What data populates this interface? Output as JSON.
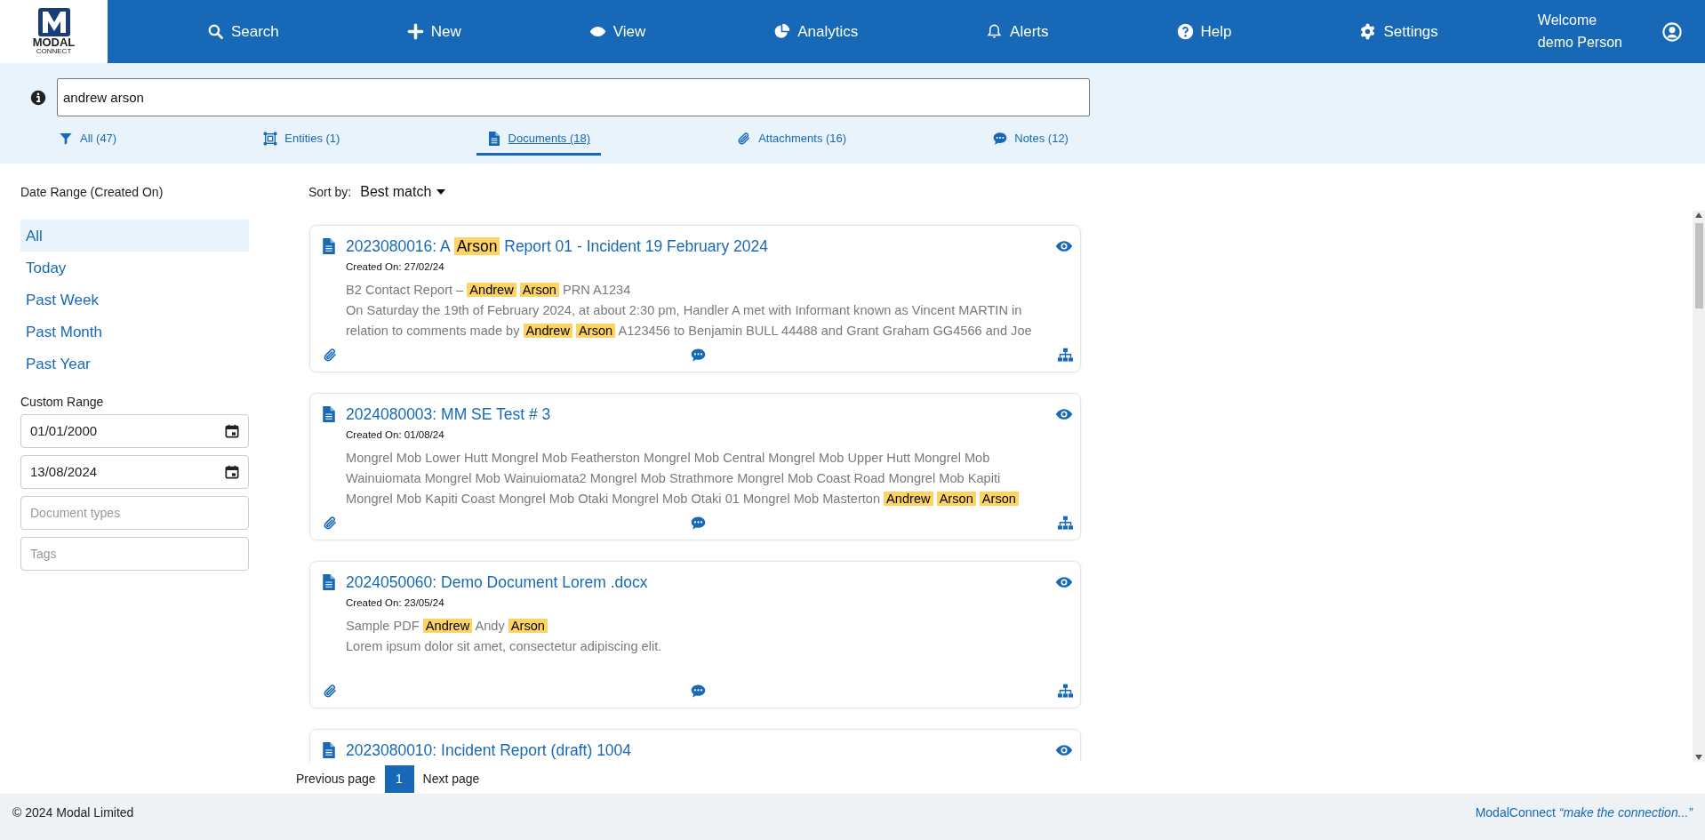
{
  "header": {
    "logo": {
      "line1": "MODAL",
      "line2": "CONNECT"
    },
    "nav": [
      {
        "label": "Search"
      },
      {
        "label": "New"
      },
      {
        "label": "View"
      },
      {
        "label": "Analytics"
      },
      {
        "label": "Alerts"
      },
      {
        "label": "Help"
      },
      {
        "label": "Settings"
      }
    ],
    "welcome": [
      "Welcome",
      "demo Person"
    ]
  },
  "search": {
    "value": "andrew arson"
  },
  "filters": [
    {
      "label": "All (47)",
      "selected": false
    },
    {
      "label": "Entities (1)",
      "selected": false
    },
    {
      "label": "Documents (18)",
      "selected": true
    },
    {
      "label": "Attachments (16)",
      "selected": false
    },
    {
      "label": "Notes (12)",
      "selected": false
    }
  ],
  "sidebar": {
    "heading": "Date Range (Created On)",
    "ranges": [
      {
        "label": "All",
        "selected": true
      },
      {
        "label": "Today",
        "selected": false
      },
      {
        "label": "Past Week",
        "selected": false
      },
      {
        "label": "Past Month",
        "selected": false
      },
      {
        "label": "Past Year",
        "selected": false
      }
    ],
    "custom_heading": "Custom Range",
    "from": "01/01/2000",
    "to": "13/08/2024",
    "doc_types": {
      "placeholder": "Document types"
    },
    "tags": {
      "placeholder": "Tags"
    }
  },
  "sort": {
    "label": "Sort by:",
    "value": "Best match"
  },
  "results": [
    {
      "title": [
        {
          "text": "2023080016: A ",
          "highlight": false
        },
        {
          "text": "Arson",
          "highlight": true
        },
        {
          "text": " Report 01 - Incident 19 February 2024",
          "highlight": false
        }
      ],
      "created": "Created On: 27/02/24",
      "snippet": [
        [
          {
            "text": "B2 Contact Report – ",
            "highlight": false
          },
          {
            "text": "Andrew",
            "highlight": true
          },
          {
            "text": "Arson",
            "highlight": true
          },
          {
            "text": " PRN A1234",
            "highlight": false
          }
        ],
        [
          {
            "text": "On Saturday the 19th of February 2024, at about 2:30 pm, Handler A met with Informant known as Vincent MARTIN in",
            "highlight": false
          }
        ],
        [
          {
            "text": "relation to comments made by ",
            "highlight": false
          },
          {
            "text": "Andrew",
            "highlight": true
          },
          {
            "text": "Arson",
            "highlight": true
          },
          {
            "text": " A123456 to Benjamin BULL 44488 and Grant Graham GG4566 and Joe",
            "highlight": false
          }
        ]
      ]
    },
    {
      "title": [
        {
          "text": "2024080003: MM SE Test # 3",
          "highlight": false
        }
      ],
      "created": "Created On: 01/08/24",
      "snippet": [
        [
          {
            "text": "Mongrel Mob Lower Hutt Mongrel Mob Featherston Mongrel Mob Central Mongrel Mob Upper Hutt Mongrel Mob",
            "highlight": false
          }
        ],
        [
          {
            "text": "Wainuiomata Mongrel Mob Wainuiomata2 Mongrel Mob Strathmore Mongrel Mob Coast Road Mongrel Mob Kapiti",
            "highlight": false
          }
        ],
        [
          {
            "text": "Mongrel Mob Kapiti Coast Mongrel Mob Otaki Mongrel Mob Otaki 01 Mongrel Mob Masterton ",
            "highlight": false
          },
          {
            "text": "Andrew",
            "highlight": true
          },
          {
            "text": "Arson",
            "highlight": true
          },
          {
            "text": "Arson",
            "highlight": true
          }
        ]
      ]
    },
    {
      "title": [
        {
          "text": "2024050060: Demo Document Lorem .docx",
          "highlight": false
        }
      ],
      "created": "Created On: 23/05/24",
      "snippet": [
        [
          {
            "text": "Sample PDF ",
            "highlight": false
          },
          {
            "text": "Andrew",
            "highlight": true
          },
          {
            "text": " Andy ",
            "highlight": false
          },
          {
            "text": "Arson",
            "highlight": true
          }
        ],
        [
          {
            "text": "Lorem ipsum dolor sit amet, consectetur adipiscing elit.",
            "highlight": false
          }
        ]
      ]
    },
    {
      "title": [
        {
          "text": "2023080010: Incident Report (draft) 1004",
          "highlight": false
        }
      ]
    }
  ],
  "pagination": {
    "previous": "Previous page",
    "pages": [
      {
        "label": "1",
        "selected": true
      }
    ],
    "next": "Next page"
  },
  "footer": {
    "copyright": "© 2024 Modal Limited",
    "brand": "ModalConnect",
    "tagline": "“make the connection...”"
  }
}
